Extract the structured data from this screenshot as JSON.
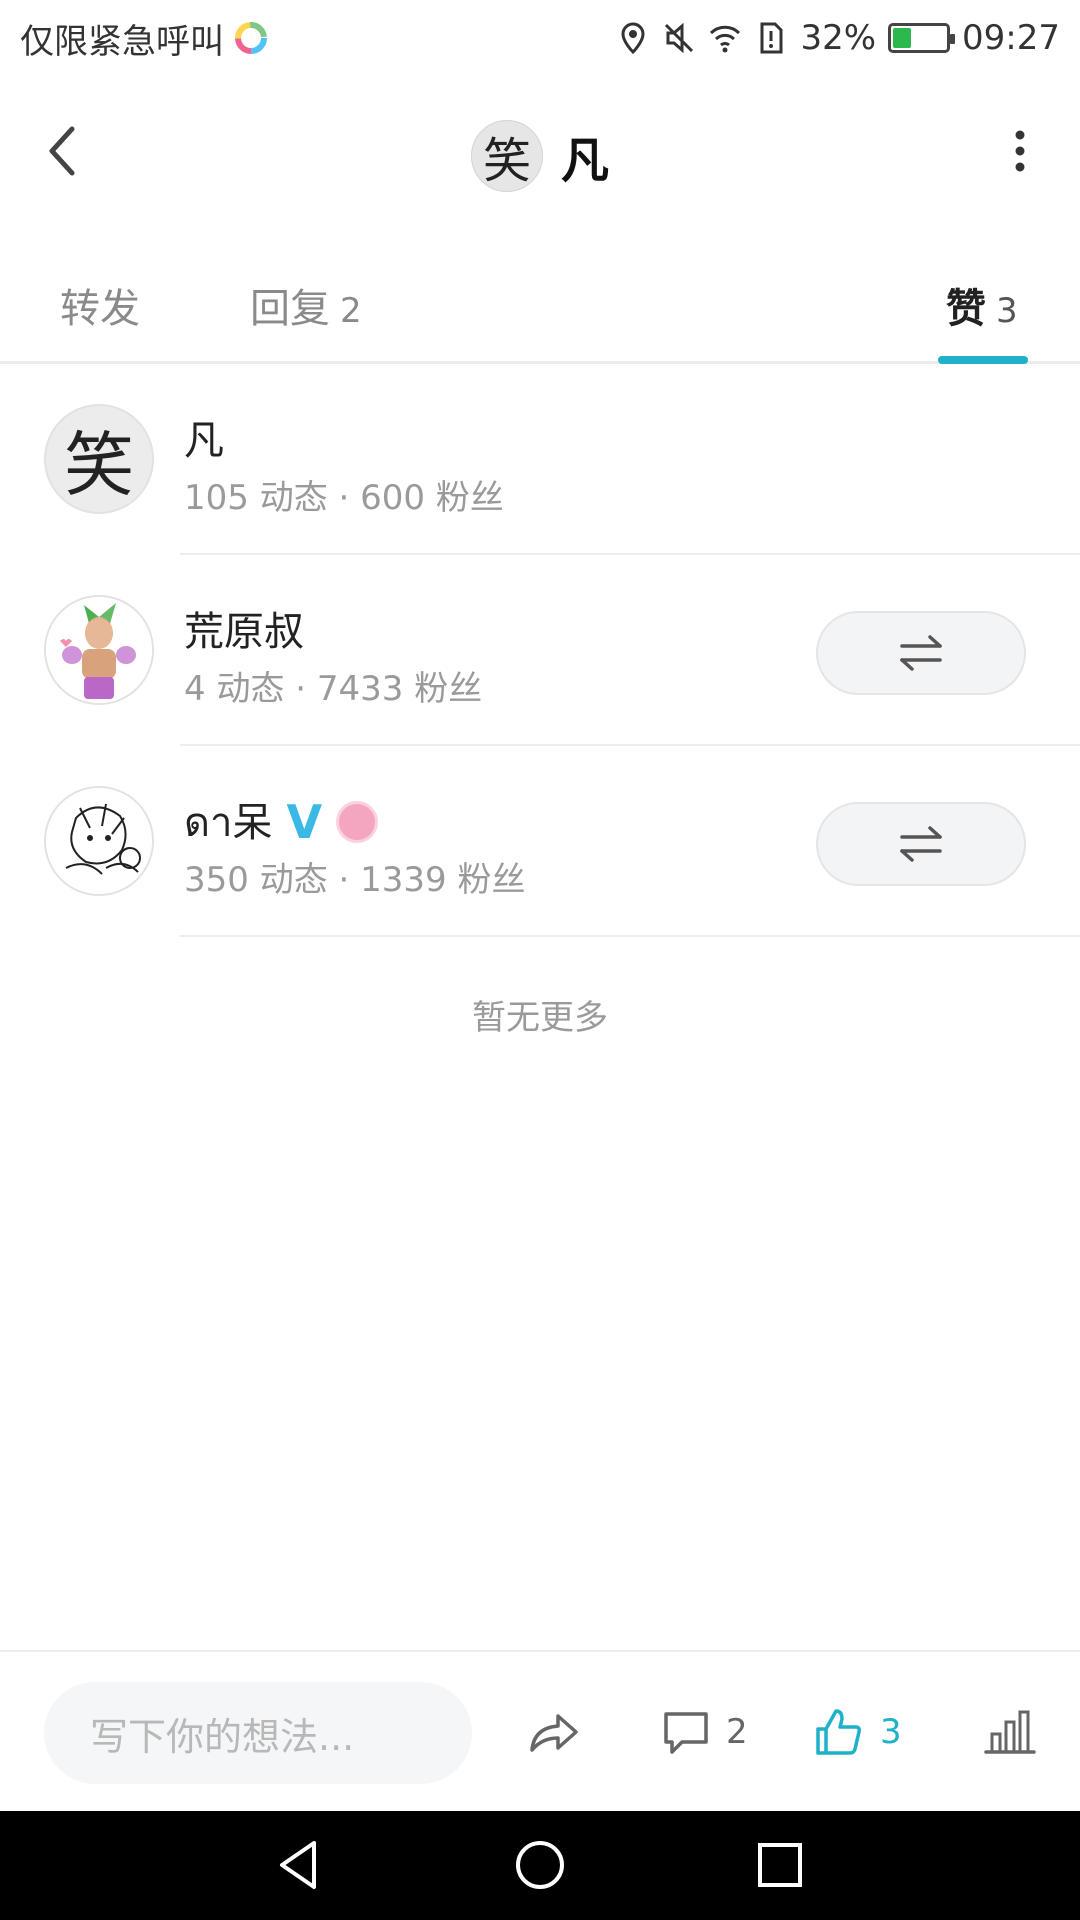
{
  "status": {
    "carrier": "仅限紧急呼叫",
    "battery_text": "32%",
    "battery_level": 0.32,
    "time": "09:27"
  },
  "header": {
    "avatar_char": "笑",
    "title": "凡"
  },
  "tabs": [
    {
      "label": "转发",
      "count": ""
    },
    {
      "label": "回复",
      "count": "2"
    },
    {
      "label": "赞",
      "count": "3"
    }
  ],
  "users": [
    {
      "avatar_char": "笑",
      "name": "凡",
      "meta": "105 动态 · 600 粉丝",
      "has_action": false
    },
    {
      "name": "荒原叔",
      "meta": "4 动态 · 7433 粉丝",
      "has_action": true
    },
    {
      "name": "ดา呆",
      "meta": "350 动态 · 1339 粉丝",
      "has_action": true,
      "badge": "V"
    }
  ],
  "list_footer": "暂无更多",
  "bottom_bar": {
    "input_placeholder": "写下你的想法...",
    "comment_count": "2",
    "like_count": "3"
  },
  "colors": {
    "accent": "#1fb1c7",
    "verified": "#3ab8e6"
  }
}
